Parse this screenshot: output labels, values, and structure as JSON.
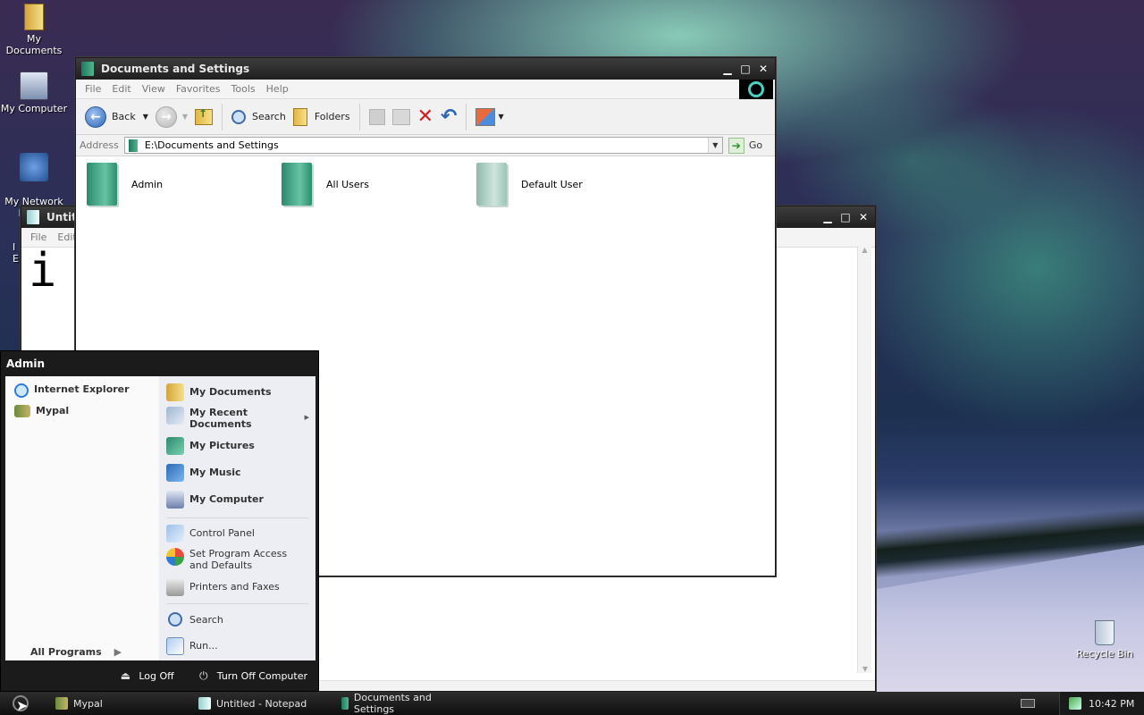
{
  "desktop": {
    "icons": [
      {
        "label": "My Documents",
        "icon": "my-documents-icon"
      },
      {
        "label": "My Computer",
        "icon": "my-computer-icon"
      },
      {
        "label": "My Network\nPlaces",
        "icon": "network-places-icon"
      },
      {
        "label": "Recycle Bin",
        "icon": "recycle-bin-icon"
      }
    ],
    "partial_icon_text": "I\nE"
  },
  "notepad_window": {
    "title": "Untitl",
    "menu": [
      "File",
      "Edit"
    ],
    "content": "i"
  },
  "explorer": {
    "title": "Documents and Settings",
    "menu": [
      "File",
      "Edit",
      "View",
      "Favorites",
      "Tools",
      "Help"
    ],
    "toolbar": {
      "back": "Back",
      "search": "Search",
      "folders": "Folders"
    },
    "address_label": "Address",
    "address_value": "E:\\Documents and Settings",
    "go_label": "Go",
    "folders": [
      "Admin",
      "All Users",
      "Default User"
    ]
  },
  "start_menu": {
    "user": "Admin",
    "pinned": [
      "Internet Explorer",
      "Mypal"
    ],
    "all_programs": "All Programs",
    "places": [
      "My Documents",
      "My Recent Documents",
      "My Pictures",
      "My Music",
      "My Computer"
    ],
    "system": [
      "Control Panel",
      "Set Program Access and Defaults",
      "Printers and Faxes"
    ],
    "tools": [
      "Search",
      "Run..."
    ],
    "log_off": "Log Off",
    "turn_off": "Turn Off Computer"
  },
  "taskbar": {
    "buttons": [
      "Mypal",
      "Untitled - Notepad",
      "Documents and Settings"
    ],
    "clock": "10:42 PM"
  },
  "colors": {
    "accent_folder": "#2a8a6e",
    "titlebar": "#1f1f1f",
    "taskbar": "#0f0f0f"
  }
}
